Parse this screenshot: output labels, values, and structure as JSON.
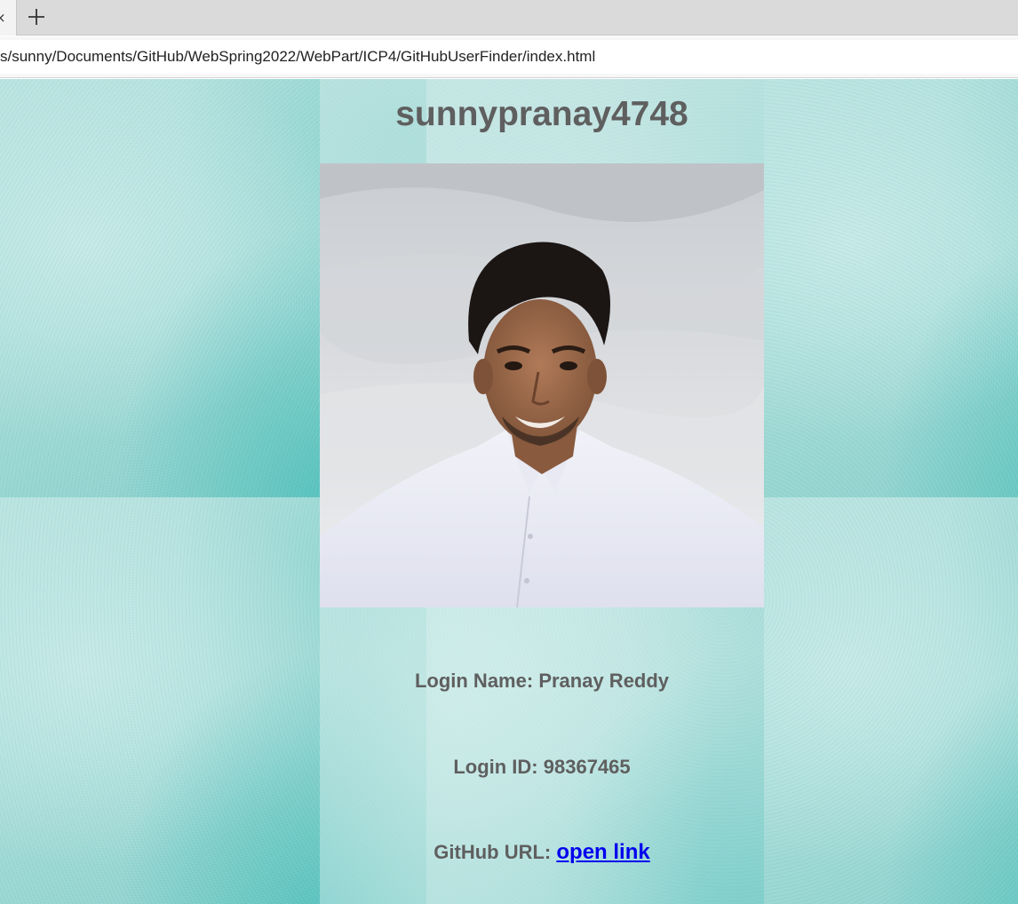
{
  "browser": {
    "tab_close_glyph": "×",
    "new_tab_icon": "plus-icon",
    "url": "s/sunny/Documents/GitHub/WebSpring2022/WebPart/ICP4/GitHubUserFinder/index.html"
  },
  "profile": {
    "username": "sunnypranay4748",
    "login_name_label": "Login Name:",
    "login_name_value": "Pranay Reddy",
    "login_id_label": "Login ID:",
    "login_id_value": "98367465",
    "github_url_label": "GitHub URL:",
    "github_url_link_text": "open link"
  },
  "colors": {
    "text_gray": "#5f5f5f",
    "link_blue": "#0000ee",
    "background_teal": "#9fd6d3"
  }
}
